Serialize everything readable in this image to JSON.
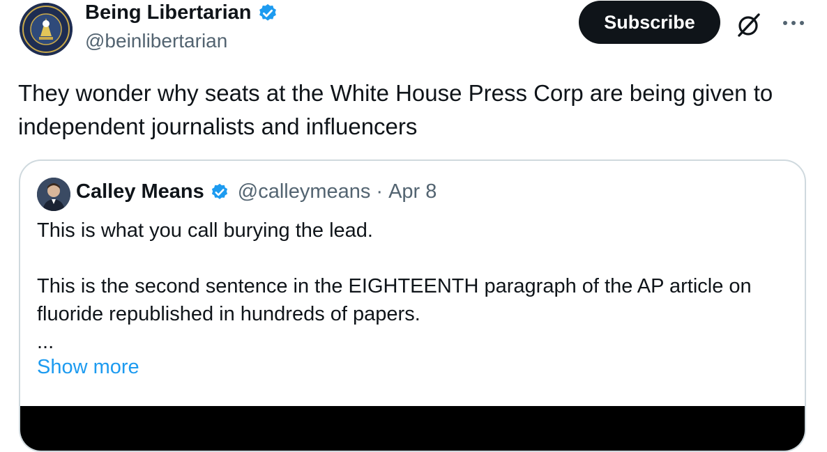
{
  "author": {
    "display_name": "Being Libertarian",
    "handle": "@beinlibertarian",
    "avatar_icon": "being-libertarian-seal-avatar",
    "verified_color": "#1d9bf0"
  },
  "actions": {
    "subscribe_label": "Subscribe",
    "grok_icon": "grok-icon",
    "more_icon": "more-options-icon"
  },
  "tweet": {
    "text": "They wonder why seats at the White House Press Corp are being given to independent journalists and influencers"
  },
  "quote": {
    "display_name": "Calley Means",
    "handle": "@calleymeans",
    "separator": "·",
    "date": "Apr 8",
    "line1": "This is what you call burying the lead.",
    "line2": "This is the second sentence in the EIGHTEENTH paragraph of the AP article on fluoride republished in hundreds of papers.",
    "ellipsis": "...",
    "show_more": "Show more",
    "avatar_icon": "person-avatar"
  },
  "colors": {
    "link": "#1d9bf0",
    "secondary_text": "#536471",
    "border": "#cfd9de",
    "button_bg": "#0f1419"
  }
}
